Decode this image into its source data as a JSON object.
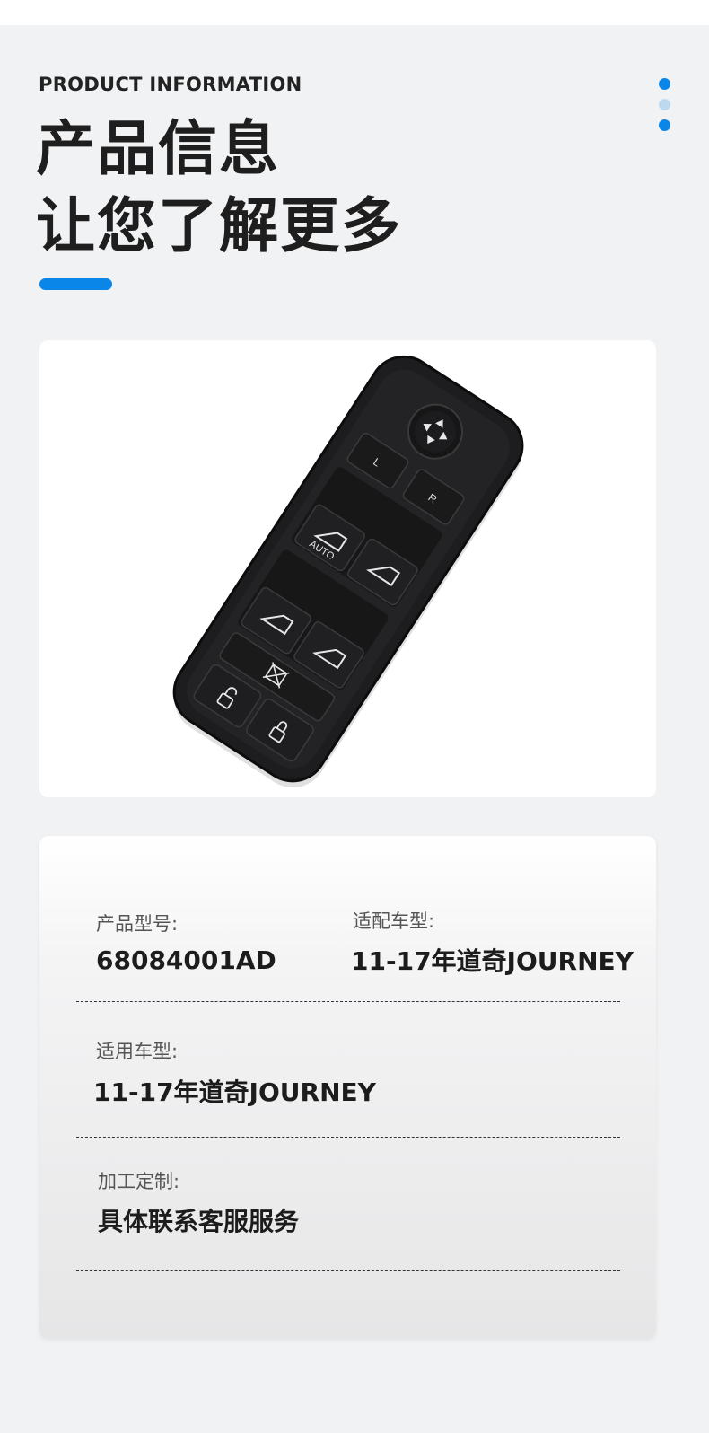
{
  "header": {
    "eyebrow": "PRODUCT INFORMATION",
    "title_line1": "产品信息",
    "title_line2": "让您了解更多",
    "accent_color": "#0a86e8"
  },
  "product_image": {
    "button_labels": {
      "mirror_left": "L",
      "mirror_right": "R",
      "auto": "AUTO"
    },
    "icons": [
      "mirror-joystick-icon",
      "window-icon",
      "window-lock-icon",
      "door-unlock-icon",
      "door-lock-icon"
    ]
  },
  "info": {
    "model_label": "产品型号:",
    "model_value": "68084001AD",
    "fit_label": "适配车型:",
    "fit_value": "11-17年道奇JOURNEY",
    "applicable_label": "适用车型:",
    "applicable_value": "11-17年道奇JOURNEY",
    "custom_label": "加工定制:",
    "custom_value": "具体联系客服服务"
  }
}
